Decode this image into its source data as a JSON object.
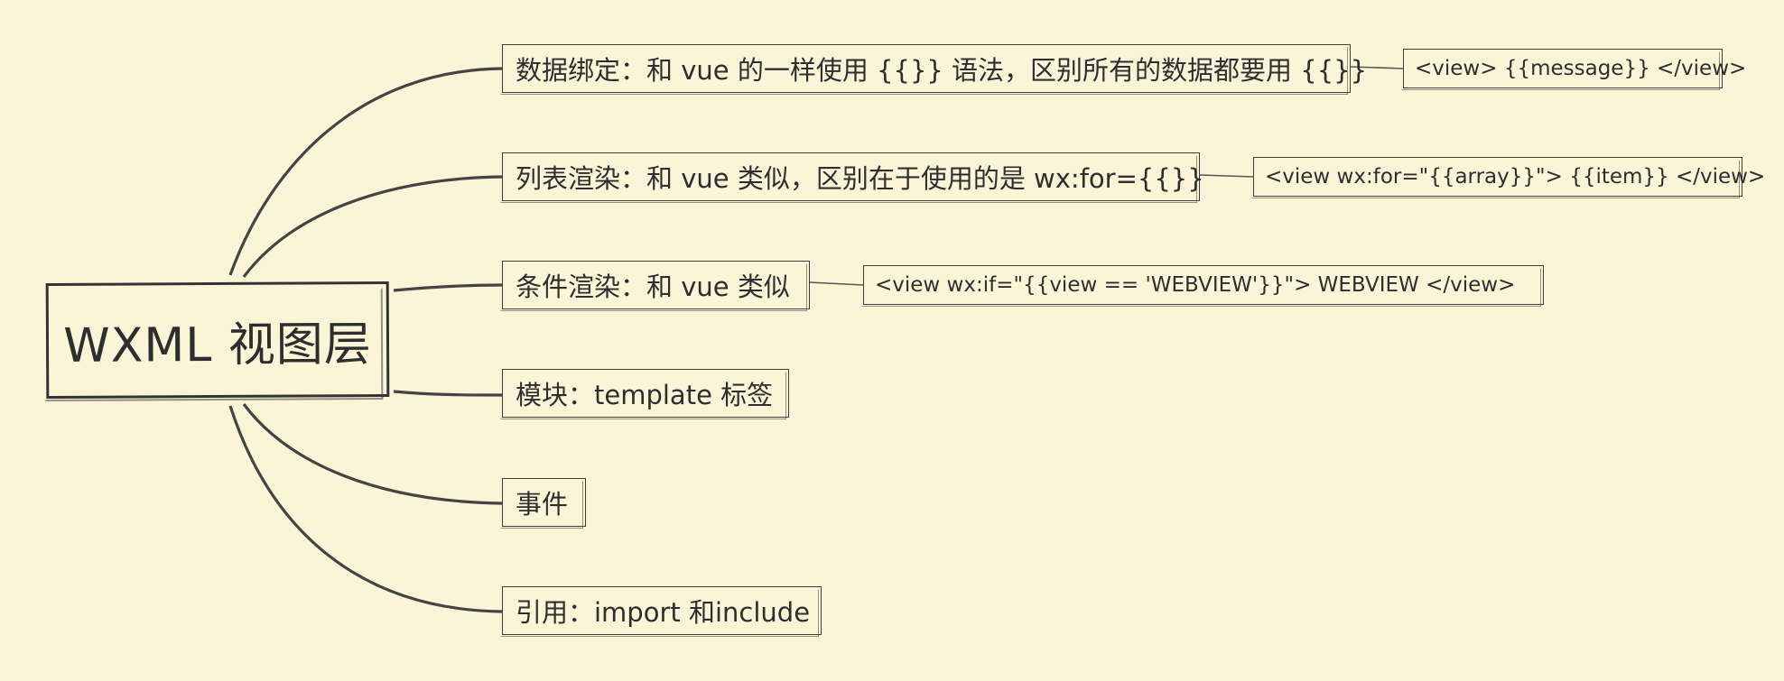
{
  "root": {
    "label": "WXML 视图层"
  },
  "branches": [
    {
      "label": "数据绑定：和 vue 的一样使用 {{}} 语法，区别所有的数据都要用 {{}}",
      "detail": "<view> {{message}} </view>"
    },
    {
      "label": "列表渲染：和 vue 类似，区别在于使用的是 wx:for={{}}",
      "detail": "<view wx:for=\"{{array}}\"> {{item}} </view>"
    },
    {
      "label": "条件渲染：和 vue 类似",
      "detail": "<view wx:if=\"{{view == 'WEBVIEW'}}\"> WEBVIEW </view>"
    },
    {
      "label": "模块：template 标签"
    },
    {
      "label": "事件"
    },
    {
      "label": "引用：import 和include"
    }
  ],
  "colors": {
    "background": "#fbf5d8",
    "stroke": "#3d3d3d",
    "text": "#2e2e2e"
  }
}
